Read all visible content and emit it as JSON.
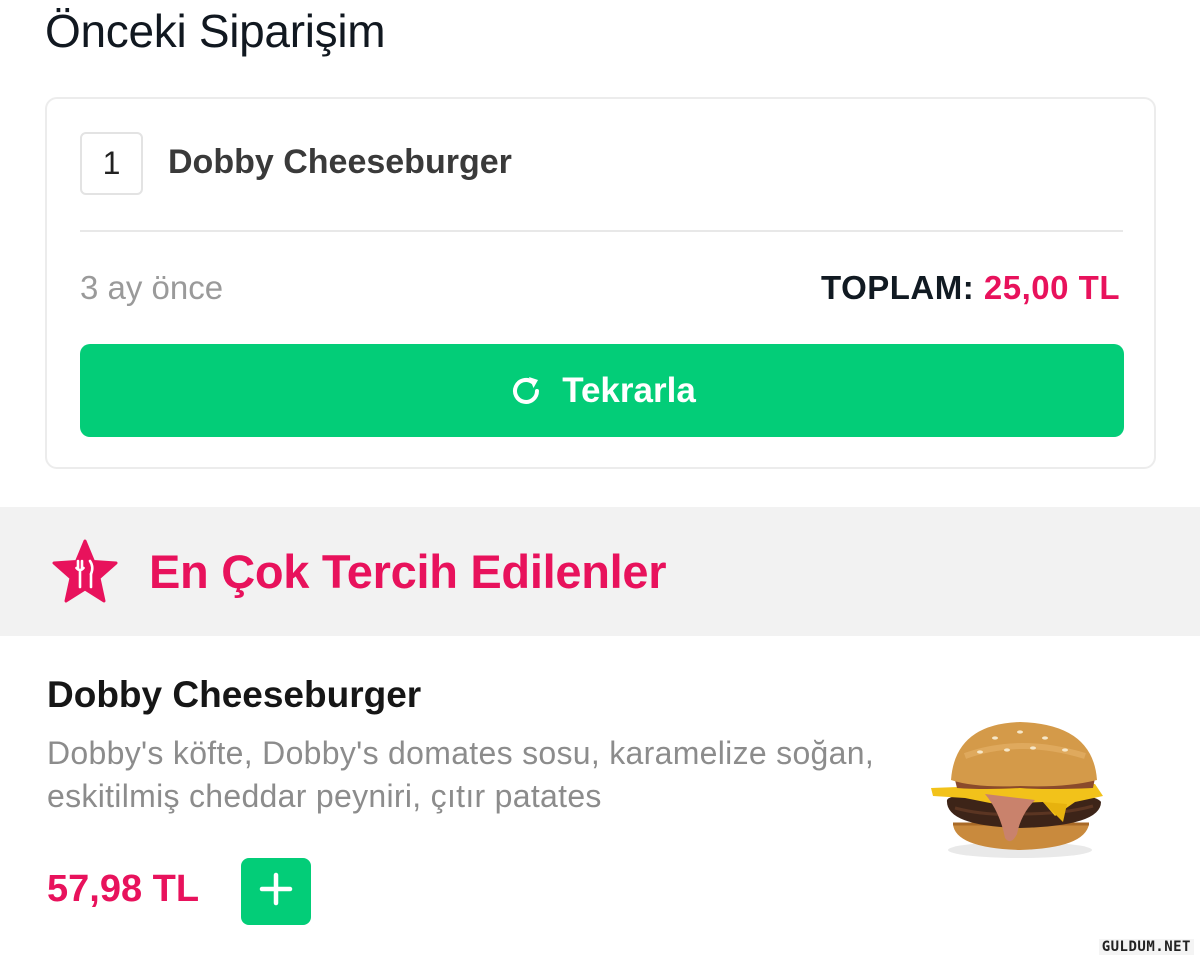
{
  "previous_order": {
    "title": "Önceki Siparişim",
    "item": {
      "quantity": "1",
      "name": "Dobby Cheeseburger"
    },
    "time_ago": "3 ay önce",
    "total_label": "TOPLAM:",
    "total_value": "25,00 TL",
    "repeat_button": {
      "label": "Tekrarla",
      "icon": "refresh-icon"
    }
  },
  "popular": {
    "title": "En Çok Tercih Edilenler",
    "icon": "star-fork-knife-icon"
  },
  "product": {
    "name": "Dobby Cheeseburger",
    "description": "Dobby's köfte, Dobby's domates sosu, karamelize soğan, eskitilmiş cheddar peyniri, çıtır patates",
    "price": "57,98 TL",
    "add_icon": "plus-icon"
  },
  "watermark": "GULDUM.NET",
  "colors": {
    "accent_green": "#03cd78",
    "accent_pink": "#e8125c",
    "band_gray": "#f2f2f2"
  }
}
